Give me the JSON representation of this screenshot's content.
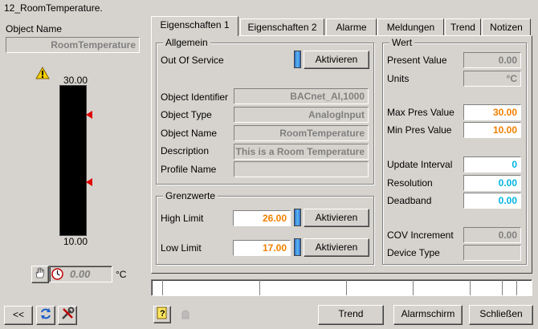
{
  "window": {
    "title": "12_RoomTemperature."
  },
  "left": {
    "object_name_label": "Object Name",
    "object_name_value": "RoomTemperature",
    "scale_max": "30.00",
    "scale_min": "10.00",
    "value": "0.00",
    "unit": "°C",
    "warning_icon": "warning-triangle-icon",
    "hand_icon": "hand-icon",
    "clock_icon": "clock-icon"
  },
  "tabs": [
    "Eigenschaften 1",
    "Eigenschaften 2",
    "Alarme",
    "Meldungen",
    "Trend",
    "Notizen"
  ],
  "allgemein": {
    "title": "Allgemein",
    "out_of_service_label": "Out Of Service",
    "activate_label": "Aktivieren",
    "rows": [
      {
        "label": "Object Identifier",
        "value": "BACnet_AI,1000"
      },
      {
        "label": "Object Type",
        "value": "AnalogInput"
      },
      {
        "label": "Object Name",
        "value": "RoomTemperature"
      },
      {
        "label": "Description",
        "value": "This is a Room Temperature"
      },
      {
        "label": "Profile Name",
        "value": ""
      }
    ]
  },
  "grenzwerte": {
    "title": "Grenzwerte",
    "high_label": "High Limit",
    "high_value": "26.00",
    "low_label": "Low Limit",
    "low_value": "17.00",
    "activate_label": "Aktivieren"
  },
  "wert": {
    "title": "Wert",
    "present_value_label": "Present Value",
    "present_value": "0.00",
    "units_label": "Units",
    "units": "°C",
    "max_pres_label": "Max Pres Value",
    "max_pres": "30.00",
    "min_pres_label": "Min Pres Value",
    "min_pres": "10.00",
    "update_interval_label": "Update Interval",
    "update_interval": "0",
    "resolution_label": "Resolution",
    "resolution": "0.00",
    "deadband_label": "Deadband",
    "deadband": "0.00",
    "cov_label": "COV Increment",
    "cov": "0.00",
    "device_type_label": "Device Type",
    "device_type": ""
  },
  "footer": {
    "collapse_label": "<<",
    "trend_label": "Trend",
    "alarm_label": "Alarmschirm",
    "close_label": "Schließen"
  },
  "colors": {
    "orange": "#f08000",
    "cyan": "#00b4e0",
    "bar": "#000000",
    "marker": "#e00000"
  }
}
